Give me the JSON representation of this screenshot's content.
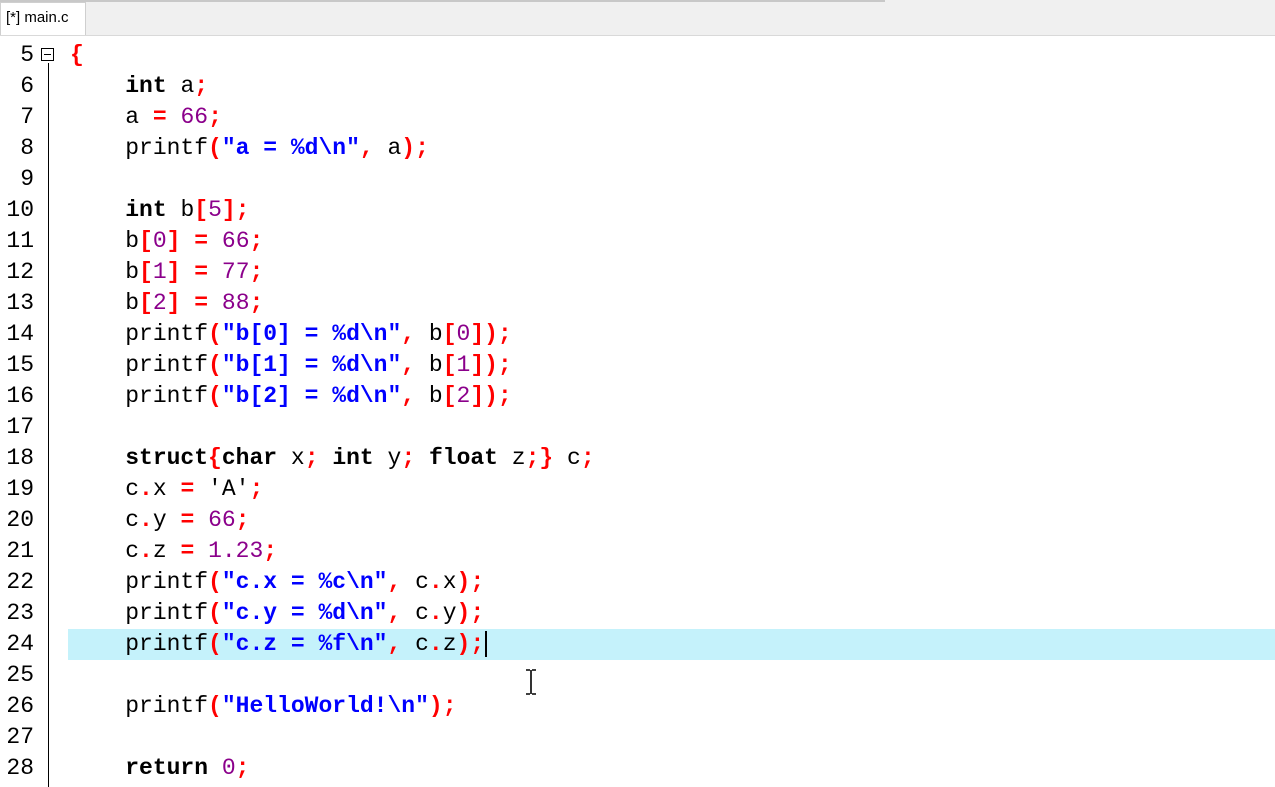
{
  "tab": {
    "label": "[*] main.c"
  },
  "editor": {
    "current_line": 24,
    "lines": [
      {
        "n": "5",
        "tokens": [
          {
            "t": "{",
            "c": "sym"
          }
        ]
      },
      {
        "n": "6",
        "tokens": [
          {
            "t": "    ",
            "c": ""
          },
          {
            "t": "int",
            "c": "kw"
          },
          {
            "t": " a",
            "c": ""
          },
          {
            "t": ";",
            "c": "sym"
          }
        ]
      },
      {
        "n": "7",
        "tokens": [
          {
            "t": "    a ",
            "c": ""
          },
          {
            "t": "=",
            "c": "sym"
          },
          {
            "t": " ",
            "c": ""
          },
          {
            "t": "66",
            "c": "num"
          },
          {
            "t": ";",
            "c": "sym"
          }
        ]
      },
      {
        "n": "8",
        "tokens": [
          {
            "t": "    printf",
            "c": ""
          },
          {
            "t": "(",
            "c": "sym"
          },
          {
            "t": "\"a = %d\\n\"",
            "c": "str"
          },
          {
            "t": ",",
            "c": "sym"
          },
          {
            "t": " a",
            "c": ""
          },
          {
            "t": ");",
            "c": "sym"
          }
        ]
      },
      {
        "n": "9",
        "tokens": []
      },
      {
        "n": "10",
        "tokens": [
          {
            "t": "    ",
            "c": ""
          },
          {
            "t": "int",
            "c": "kw"
          },
          {
            "t": " b",
            "c": ""
          },
          {
            "t": "[",
            "c": "sym"
          },
          {
            "t": "5",
            "c": "num"
          },
          {
            "t": "];",
            "c": "sym"
          }
        ]
      },
      {
        "n": "11",
        "tokens": [
          {
            "t": "    b",
            "c": ""
          },
          {
            "t": "[",
            "c": "sym"
          },
          {
            "t": "0",
            "c": "num"
          },
          {
            "t": "]",
            "c": "sym"
          },
          {
            "t": " ",
            "c": ""
          },
          {
            "t": "=",
            "c": "sym"
          },
          {
            "t": " ",
            "c": ""
          },
          {
            "t": "66",
            "c": "num"
          },
          {
            "t": ";",
            "c": "sym"
          }
        ]
      },
      {
        "n": "12",
        "tokens": [
          {
            "t": "    b",
            "c": ""
          },
          {
            "t": "[",
            "c": "sym"
          },
          {
            "t": "1",
            "c": "num"
          },
          {
            "t": "]",
            "c": "sym"
          },
          {
            "t": " ",
            "c": ""
          },
          {
            "t": "=",
            "c": "sym"
          },
          {
            "t": " ",
            "c": ""
          },
          {
            "t": "77",
            "c": "num"
          },
          {
            "t": ";",
            "c": "sym"
          }
        ]
      },
      {
        "n": "13",
        "tokens": [
          {
            "t": "    b",
            "c": ""
          },
          {
            "t": "[",
            "c": "sym"
          },
          {
            "t": "2",
            "c": "num"
          },
          {
            "t": "]",
            "c": "sym"
          },
          {
            "t": " ",
            "c": ""
          },
          {
            "t": "=",
            "c": "sym"
          },
          {
            "t": " ",
            "c": ""
          },
          {
            "t": "88",
            "c": "num"
          },
          {
            "t": ";",
            "c": "sym"
          }
        ]
      },
      {
        "n": "14",
        "tokens": [
          {
            "t": "    printf",
            "c": ""
          },
          {
            "t": "(",
            "c": "sym"
          },
          {
            "t": "\"b[0] = %d\\n\"",
            "c": "str"
          },
          {
            "t": ",",
            "c": "sym"
          },
          {
            "t": " b",
            "c": ""
          },
          {
            "t": "[",
            "c": "sym"
          },
          {
            "t": "0",
            "c": "num"
          },
          {
            "t": "]);",
            "c": "sym"
          }
        ]
      },
      {
        "n": "15",
        "tokens": [
          {
            "t": "    printf",
            "c": ""
          },
          {
            "t": "(",
            "c": "sym"
          },
          {
            "t": "\"b[1] = %d\\n\"",
            "c": "str"
          },
          {
            "t": ",",
            "c": "sym"
          },
          {
            "t": " b",
            "c": ""
          },
          {
            "t": "[",
            "c": "sym"
          },
          {
            "t": "1",
            "c": "num"
          },
          {
            "t": "]);",
            "c": "sym"
          }
        ]
      },
      {
        "n": "16",
        "tokens": [
          {
            "t": "    printf",
            "c": ""
          },
          {
            "t": "(",
            "c": "sym"
          },
          {
            "t": "\"b[2] = %d\\n\"",
            "c": "str"
          },
          {
            "t": ",",
            "c": "sym"
          },
          {
            "t": " b",
            "c": ""
          },
          {
            "t": "[",
            "c": "sym"
          },
          {
            "t": "2",
            "c": "num"
          },
          {
            "t": "]);",
            "c": "sym"
          }
        ]
      },
      {
        "n": "17",
        "tokens": []
      },
      {
        "n": "18",
        "tokens": [
          {
            "t": "    ",
            "c": ""
          },
          {
            "t": "struct",
            "c": "kw"
          },
          {
            "t": "{",
            "c": "sym"
          },
          {
            "t": "char",
            "c": "kw"
          },
          {
            "t": " x",
            "c": ""
          },
          {
            "t": ";",
            "c": "sym"
          },
          {
            "t": " ",
            "c": ""
          },
          {
            "t": "int",
            "c": "kw"
          },
          {
            "t": " y",
            "c": ""
          },
          {
            "t": ";",
            "c": "sym"
          },
          {
            "t": " ",
            "c": ""
          },
          {
            "t": "float",
            "c": "kw"
          },
          {
            "t": " z",
            "c": ""
          },
          {
            "t": ";}",
            "c": "sym"
          },
          {
            "t": " c",
            "c": ""
          },
          {
            "t": ";",
            "c": "sym"
          }
        ]
      },
      {
        "n": "19",
        "tokens": [
          {
            "t": "    c",
            "c": ""
          },
          {
            "t": ".",
            "c": "sym"
          },
          {
            "t": "x ",
            "c": ""
          },
          {
            "t": "=",
            "c": "sym"
          },
          {
            "t": " 'A'",
            "c": "chr"
          },
          {
            "t": ";",
            "c": "sym"
          }
        ]
      },
      {
        "n": "20",
        "tokens": [
          {
            "t": "    c",
            "c": ""
          },
          {
            "t": ".",
            "c": "sym"
          },
          {
            "t": "y ",
            "c": ""
          },
          {
            "t": "=",
            "c": "sym"
          },
          {
            "t": " ",
            "c": ""
          },
          {
            "t": "66",
            "c": "num"
          },
          {
            "t": ";",
            "c": "sym"
          }
        ]
      },
      {
        "n": "21",
        "tokens": [
          {
            "t": "    c",
            "c": ""
          },
          {
            "t": ".",
            "c": "sym"
          },
          {
            "t": "z ",
            "c": ""
          },
          {
            "t": "=",
            "c": "sym"
          },
          {
            "t": " ",
            "c": ""
          },
          {
            "t": "1.23",
            "c": "num"
          },
          {
            "t": ";",
            "c": "sym"
          }
        ]
      },
      {
        "n": "22",
        "tokens": [
          {
            "t": "    printf",
            "c": ""
          },
          {
            "t": "(",
            "c": "sym"
          },
          {
            "t": "\"c.x = %c\\n\"",
            "c": "str"
          },
          {
            "t": ",",
            "c": "sym"
          },
          {
            "t": " c",
            "c": ""
          },
          {
            "t": ".",
            "c": "sym"
          },
          {
            "t": "x",
            "c": ""
          },
          {
            "t": ");",
            "c": "sym"
          }
        ]
      },
      {
        "n": "23",
        "tokens": [
          {
            "t": "    printf",
            "c": ""
          },
          {
            "t": "(",
            "c": "sym"
          },
          {
            "t": "\"c.y = %d\\n\"",
            "c": "str"
          },
          {
            "t": ",",
            "c": "sym"
          },
          {
            "t": " c",
            "c": ""
          },
          {
            "t": ".",
            "c": "sym"
          },
          {
            "t": "y",
            "c": ""
          },
          {
            "t": ");",
            "c": "sym"
          }
        ]
      },
      {
        "n": "24",
        "tokens": [
          {
            "t": "    printf",
            "c": ""
          },
          {
            "t": "(",
            "c": "sym"
          },
          {
            "t": "\"c.z = %f\\n\"",
            "c": "str"
          },
          {
            "t": ",",
            "c": "sym"
          },
          {
            "t": " c",
            "c": ""
          },
          {
            "t": ".",
            "c": "sym"
          },
          {
            "t": "z",
            "c": ""
          },
          {
            "t": ");",
            "c": "sym"
          }
        ]
      },
      {
        "n": "25",
        "tokens": []
      },
      {
        "n": "26",
        "tokens": [
          {
            "t": "    printf",
            "c": ""
          },
          {
            "t": "(",
            "c": "sym"
          },
          {
            "t": "\"HelloWorld!\\n\"",
            "c": "str"
          },
          {
            "t": ");",
            "c": "sym"
          }
        ]
      },
      {
        "n": "27",
        "tokens": []
      },
      {
        "n": "28",
        "tokens": [
          {
            "t": "    ",
            "c": ""
          },
          {
            "t": "return",
            "c": "kw"
          },
          {
            "t": " ",
            "c": ""
          },
          {
            "t": "0",
            "c": "num"
          },
          {
            "t": ";",
            "c": "sym"
          }
        ]
      }
    ]
  }
}
